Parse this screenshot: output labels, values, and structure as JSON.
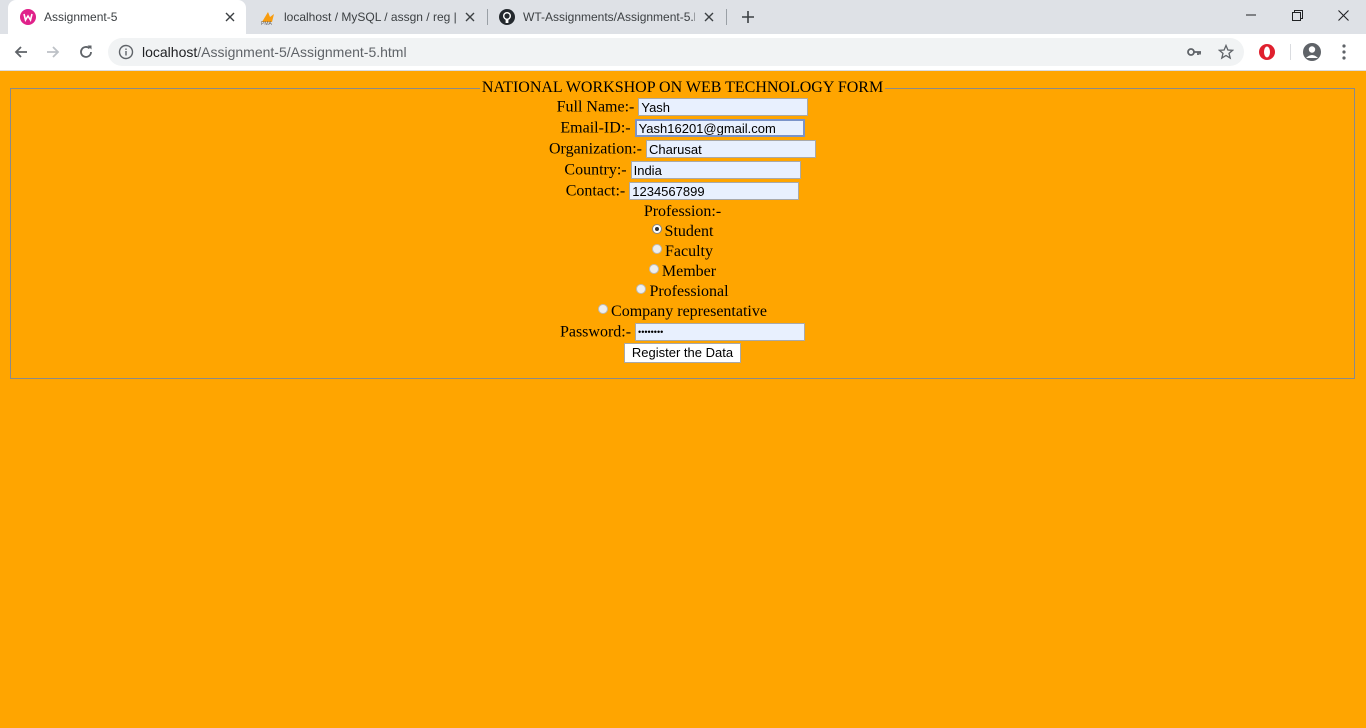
{
  "browser": {
    "tabs": [
      {
        "title": "Assignment-5",
        "active": true,
        "favicon": "wamp-icon"
      },
      {
        "title": "localhost / MySQL / assgn / reg |",
        "active": false,
        "favicon": "phpmyadmin-icon"
      },
      {
        "title": "WT-Assignments/Assignment-5.h",
        "active": false,
        "favicon": "github-icon"
      }
    ],
    "address": {
      "host": "localhost",
      "path": "/Assignment-5/Assignment-5.html"
    }
  },
  "form": {
    "legend": "NATIONAL WORKSHOP ON WEB TECHNOLOGY FORM",
    "fields": {
      "full_name": {
        "label": "Full Name:-",
        "value": "Yash"
      },
      "email": {
        "label": "Email-ID:-",
        "value": "Yash16201@gmail.com"
      },
      "organization": {
        "label": "Organization:-",
        "value": "Charusat"
      },
      "country": {
        "label": "Country:-",
        "value": "India"
      },
      "contact": {
        "label": "Contact:-",
        "value": "1234567899"
      }
    },
    "profession": {
      "label": "Profession:-",
      "options": [
        "Student",
        "Faculty",
        "Member",
        "Professional",
        "Company representative"
      ],
      "selected": "Student"
    },
    "password": {
      "label": "Password:-",
      "value": "••••••••"
    },
    "submit_label": "Register the Data"
  },
  "colors": {
    "page_background": "#ffa500",
    "input_background": "#e8f0fe"
  }
}
